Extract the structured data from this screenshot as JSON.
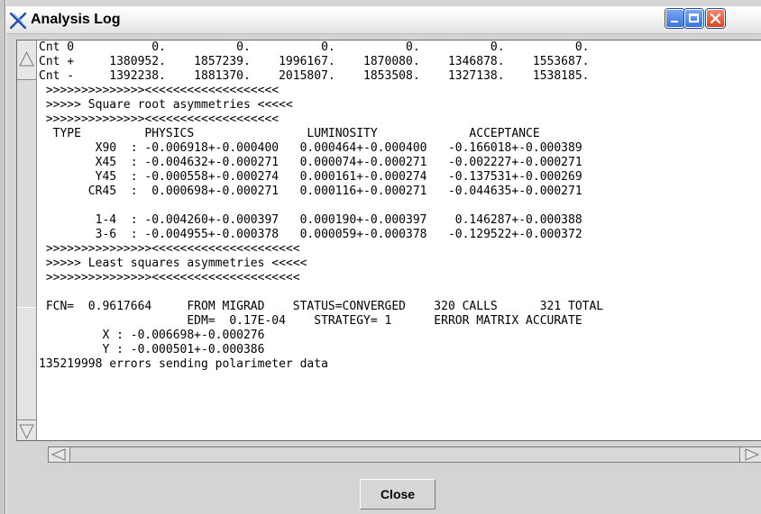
{
  "window": {
    "title": "Analysis Log"
  },
  "icons": {
    "app": "x-logo-icon",
    "minimize": "minimize-icon",
    "maximize": "maximize-icon",
    "close": "close-icon",
    "scroll_up": "triangle-up-icon",
    "scroll_down": "triangle-down-icon",
    "scroll_left": "triangle-left-icon",
    "scroll_right": "triangle-right-icon"
  },
  "colors": {
    "title_text": "#000000",
    "window_background": "#d4d4d4",
    "log_background": "#ffffff",
    "close_button_red": "#d84722",
    "control_blue": "#3d73de"
  },
  "log": {
    "lines": [
      "Cnt 0           0.          0.          0.          0.          0.          0.",
      "Cnt +     1380952.    1857239.    1996167.    1870080.    1346878.    1553687.",
      "Cnt -     1392238.    1881370.    2015807.    1853508.    1327138.    1538185.",
      " >>>>>>>>>>>>>><<<<<<<<<<<<<<<<<<<",
      " >>>>> Square root asymmetries <<<<<",
      " >>>>>>>>>>>>>><<<<<<<<<<<<<<<<<<<",
      "  TYPE         PHYSICS                LUMINOSITY             ACCEPTANCE",
      "        X90  : -0.006918+-0.000400   0.000464+-0.000400   -0.166018+-0.000389",
      "        X45  : -0.004632+-0.000271   0.000074+-0.000271   -0.002227+-0.000271",
      "        Y45  : -0.000558+-0.000274   0.000161+-0.000274   -0.137531+-0.000269",
      "       CR45  :  0.000698+-0.000271   0.000116+-0.000271   -0.044635+-0.000271",
      "",
      "        1-4  : -0.004260+-0.000397   0.000190+-0.000397    0.146287+-0.000388",
      "        3-6  : -0.004955+-0.000378   0.000059+-0.000378   -0.129522+-0.000372",
      " >>>>>>>>>>>>>>><<<<<<<<<<<<<<<<<<<<<",
      " >>>>> Least squares asymmetries <<<<<",
      " >>>>>>>>>>>>>>><<<<<<<<<<<<<<<<<<<<<",
      "",
      " FCN=  0.9617664     FROM MIGRAD    STATUS=CONVERGED    320 CALLS      321 TOTAL",
      "                     EDM=  0.17E-04    STRATEGY= 1      ERROR MATRIX ACCURATE",
      "         X : -0.006698+-0.000276",
      "         Y : -0.000501+-0.000386",
      "135219998 errors sending polarimeter data"
    ]
  },
  "buttons": {
    "close": "Close"
  }
}
